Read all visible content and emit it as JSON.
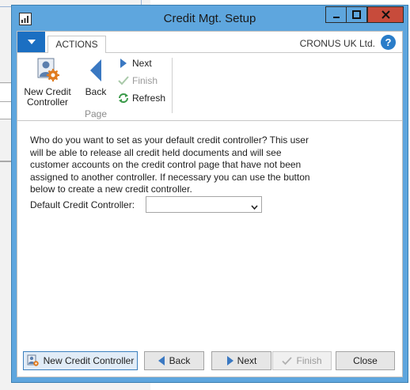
{
  "window": {
    "title": "Credit Mgt. Setup"
  },
  "ribbon": {
    "tab_label": "ACTIONS",
    "company": "CRONUS UK Ltd.",
    "help_label": "?",
    "new_credit_controller_label": "New Credit Controller",
    "back_label": "Back",
    "next_label": "Next",
    "finish_label": "Finish",
    "refresh_label": "Refresh",
    "group_label": "Page"
  },
  "content": {
    "instructions": "Who do you want to set as your default credit controller? This user will be able to release all credit held documents and will see customer accounts on the credit control page that have not been assigned to another controller. If necessary you can use the button below to create a new credit controller.",
    "field_label": "Default Credit Controller:",
    "field_value": ""
  },
  "buttons": {
    "new_credit_controller": "New Credit Controller",
    "back": "Back",
    "next": "Next",
    "finish": "Finish",
    "close": "Close"
  },
  "colors": {
    "titlebar": "#5ea6de",
    "close_button": "#c74b3b",
    "accent": "#1b6fc2",
    "nav_arrow": "#3a78c2",
    "disabled": "#9a9a9a"
  }
}
